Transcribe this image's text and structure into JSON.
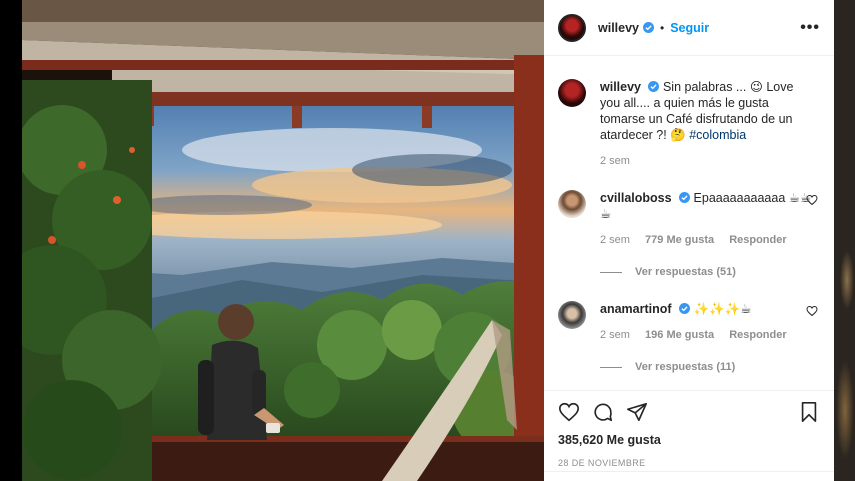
{
  "post": {
    "username": "willevy",
    "separator": "•",
    "follow_label": "Seguir",
    "more_label": "•••"
  },
  "caption": {
    "username": "willevy",
    "text": "Sin palabras ... 😉 Love you all.... a quien más le gusta tomarse un Café disfrutando de un atardecer ?! 🤔",
    "hashtag": "#colombia",
    "time": "2 sem"
  },
  "comments": [
    {
      "username": "cvillaloboss",
      "text": "Epaaaaaaaaaaa ☕☕☕",
      "time": "2 sem",
      "likes": "779 Me gusta",
      "reply_label": "Responder",
      "view_replies": "Ver respuestas (51)"
    },
    {
      "username": "anamartinof",
      "text": "✨✨✨☕",
      "time": "2 sem",
      "likes": "196 Me gusta",
      "reply_label": "Responder",
      "view_replies": "Ver respuestas (11)"
    }
  ],
  "footer": {
    "likes": "385,620 Me gusta",
    "date": "28 DE NOVIEMBRE"
  },
  "colors": {
    "link": "#0095f6",
    "verified": "#3897f0",
    "muted": "#8e8e8e"
  },
  "icons": [
    "verified-icon",
    "heart-icon",
    "comment-icon",
    "share-icon",
    "bookmark-icon",
    "more-icon"
  ]
}
